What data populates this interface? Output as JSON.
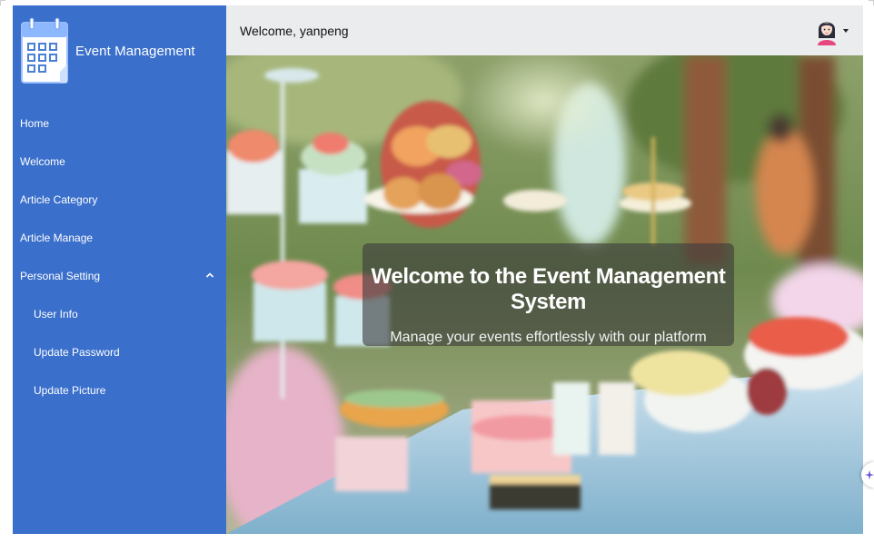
{
  "brand": {
    "title": "Event Management",
    "logo_icon": "calendar-icon"
  },
  "sidebar": {
    "items": [
      {
        "label": "Home"
      },
      {
        "label": "Welcome"
      },
      {
        "label": "Article Category"
      },
      {
        "label": "Article Manage"
      },
      {
        "label": "Personal Setting",
        "expanded": true
      },
      {
        "label": "User Info"
      },
      {
        "label": "Update Password"
      },
      {
        "label": "Update Picture"
      }
    ]
  },
  "header": {
    "welcome_text": "Welcome, yanpeng",
    "avatar_icon": "user-avatar-icon"
  },
  "hero": {
    "title": "Welcome to the Event Management System",
    "subtitle": "Manage your events effortlessly with our platform"
  },
  "colors": {
    "sidebar": "#3a6fcb",
    "header": "#eaeced",
    "banner": "rgba(60,60,60,0.62)"
  }
}
